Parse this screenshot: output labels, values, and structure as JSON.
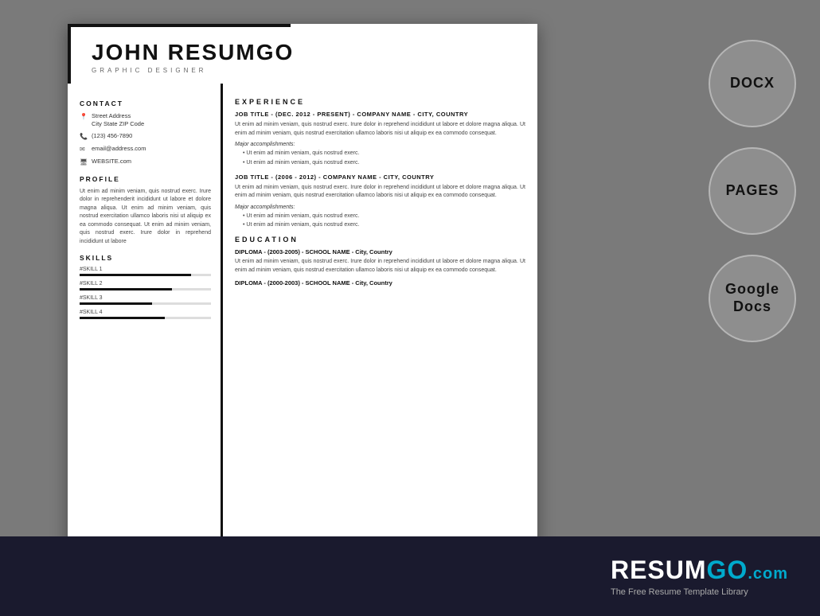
{
  "page": {
    "bg_color": "#7a7a7a"
  },
  "resume": {
    "name": "JOHN RESUMGO",
    "title": "GRAPHIC DESIGNER",
    "contact_section": "CONTACT",
    "address_line1": "Street Address",
    "address_line2": "City State ZIP Code",
    "phone": "(123) 456-7890",
    "email": "email@address.com",
    "website": "WEBSITE.com",
    "profile_section": "PROFILE",
    "profile_text": "Ut enim ad minim veniam, quis nostrud exerc. Irure dolor in reprehenderit incididunt ut labore et dolore magna aliqua. Ut enim ad minim veniam, quis nostrud exercitation ullamco laboris nisi ut aliquip ex ea commodo consequat. Ut enim ad minim veniam, quis nostrud exerc. Irure dolor in reprehend incididunt ut labore",
    "skills_section": "SKILLS",
    "skills": [
      {
        "name": "#SKILL 1",
        "level": 85
      },
      {
        "name": "#SKILL 2",
        "level": 70
      },
      {
        "name": "#SKILL 3",
        "level": 55
      },
      {
        "name": "#SKILL 4",
        "level": 65
      }
    ],
    "experience_section": "EXPERIENCE",
    "jobs": [
      {
        "title": "JOB TITLE - (DEC. 2012 - PRESENT) - COMPANY NAME - CITY, COUNTRY",
        "desc": "Ut enim ad minim veniam, quis nostrud exerc. Irure dolor in reprehend incididunt ut labore et dolore magna aliqua. Ut enim ad minim veniam, quis nostrud exercitation ullamco laboris nisi ut aliquip ex ea commodo consequat.",
        "accomplishments_label": "Major accomplishments:",
        "bullets": [
          "Ut enim ad minim veniam, quis nostrud exerc.",
          "Ut enim ad minim veniam, quis nostrud exerc."
        ]
      },
      {
        "title": "JOB TITLE - (2006 - 2012) - COMPANY NAME - CITY, COUNTRY",
        "desc": "Ut enim ad minim veniam, quis nostrud exerc. Irure dolor in reprehend incididunt ut labore et dolore magna aliqua. Ut enim ad minim veniam, quis nostrud exercitation ullamco laboris nisi ut aliquip ex ea commodo consequat.",
        "accomplishments_label": "Major accomplishments:",
        "bullets": [
          "Ut enim ad minim veniam, quis nostrud exerc.",
          "Ut enim ad minim veniam, quis nostrud exerc."
        ]
      }
    ],
    "education_section": "EDUCATION",
    "education": [
      {
        "title": "DIPLOMA - (2003-2005) - SCHOOL NAME - City, Country",
        "desc": "Ut enim ad minim veniam, quis nostrud exerc. Irure dolor in reprehend incididunt ut labore et dolore magna aliqua. Ut enim ad minim veniam, quis nostrud exercitation ullamco laboris nisi ut aliquip ex ea commodo consequat."
      },
      {
        "title": "DIPLOMA - (2000-2003) - SCHOOL NAME - City, Country",
        "desc": ""
      }
    ]
  },
  "formats": [
    {
      "label": "DOCX"
    },
    {
      "label": "PAGES"
    },
    {
      "label": "Google\nDocs"
    }
  ],
  "brand": {
    "name_resum": "RESUM",
    "name_go": "GO",
    "dot_com": ".com",
    "tagline": "The Free Resume Template Library"
  }
}
